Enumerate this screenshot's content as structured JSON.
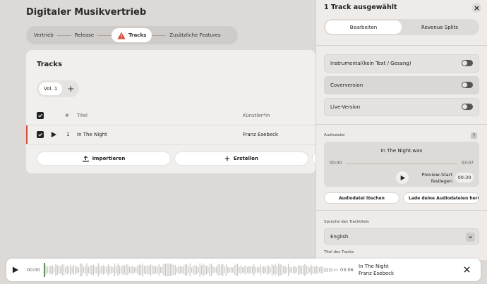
{
  "app": {
    "title": "Digitaler Musikvertrieb"
  },
  "stepper": {
    "steps": [
      "Vertrieb",
      "Release",
      "Tracks",
      "Zusätzliche Features"
    ]
  },
  "tracks_card": {
    "title": "Tracks",
    "volume_label": "Vol. 1",
    "columns": {
      "num": "#",
      "title": "Titel",
      "artist": "Künstler*in"
    },
    "rows": [
      {
        "num": "1",
        "title": "In The Night",
        "artist": "Franz Esebeck"
      }
    ],
    "import_label": "Importieren",
    "create_label": "Erstellen"
  },
  "panel": {
    "title": "1 Track ausgewählt",
    "tabs": [
      "Bearbeiten",
      "Revenue Splits"
    ],
    "toggles": [
      "Instrumental(kein Text / Gesang)",
      "Coverversion",
      "Live-Version"
    ],
    "audio_label": "Audiodatei",
    "help": "?",
    "file_name": "In The Night.wav",
    "time_start": "00:00",
    "time_end": "03:07",
    "preview_label_1": "Preview-Start",
    "preview_label_2": "festlegen",
    "preview_value": "00:30",
    "delete_label": "Audiodatei löschen",
    "upload_label": "Lade deine Audiodateien herunter",
    "language_label": "Sprache des Tracktitels",
    "language_value": "English",
    "title_label": "Titel des Tracks"
  },
  "player": {
    "time_start": "00:00",
    "time_end": "03:06",
    "track_title": "In The Night",
    "artist": "Franz Esebeck",
    "progress": 0.0
  },
  "colors": {
    "accent_red": "#d64a3c",
    "progress_green": "#2e6b2a"
  }
}
